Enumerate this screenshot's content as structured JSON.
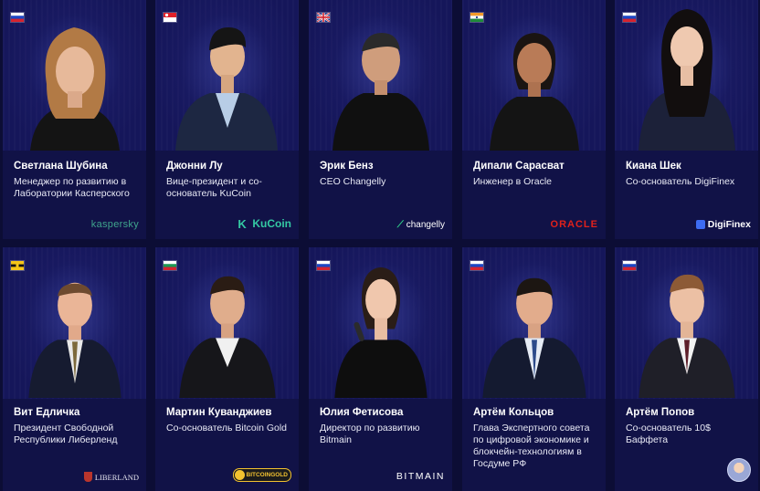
{
  "speakers": [
    {
      "name": "Светлана Шубина",
      "role": "Менеджер по развитию в Лаборатории Касперского",
      "country": "Russia",
      "logo": "kaspersky"
    },
    {
      "name": "Джонни Лу",
      "role": "Вице-президент и со-основатель KuCoin",
      "country": "Singapore",
      "logo": "KuCoin"
    },
    {
      "name": "Эрик Бенз",
      "role": "CEO Changelly",
      "country": "United Kingdom",
      "logo": "changelly"
    },
    {
      "name": "Дипали Сарасват",
      "role": "Инженер в Oracle",
      "country": "India",
      "logo": "ORACLE"
    },
    {
      "name": "Киана Шек",
      "role": "Со-основатель DigiFinex",
      "country": "Russia",
      "logo": "DigiFinex"
    },
    {
      "name": "Вит Едличка",
      "role": "Президент Свободной Республики Либерленд",
      "country": "Liberland",
      "logo": "LIBERLAND"
    },
    {
      "name": "Мартин Куванджиев",
      "role": "Со-основатель Bitcoin Gold",
      "country": "Bulgaria",
      "logo": "BITCOINGOLD"
    },
    {
      "name": "Юлия Фетисова",
      "role": "Директор по развитию Bitmain",
      "country": "Russia",
      "logo": "BITMAIN"
    },
    {
      "name": "Артём Кольцов",
      "role": "Глава Экспертного совета по цифровой экономике и блокчейн-технологиям в Госдуме РФ",
      "country": "Russia",
      "logo": "emblem"
    },
    {
      "name": "Артём Попов",
      "role": "Со-основатель 10$ Баффета",
      "country": "Russia",
      "logo": "avatar"
    }
  ],
  "colors": {
    "background": "#0c0d35",
    "card": "#111247",
    "text": "#ffffff"
  }
}
